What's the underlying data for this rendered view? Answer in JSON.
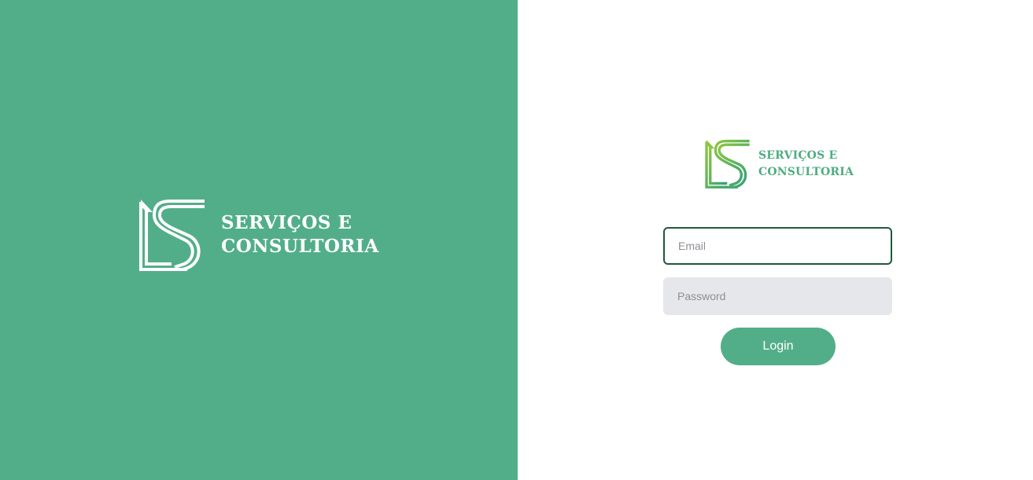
{
  "brand": {
    "line1": "SERVIÇOS E",
    "line2": "CONSULTORIA"
  },
  "login_form": {
    "email_placeholder": "Email",
    "password_placeholder": "Password",
    "login_label": "Login"
  },
  "colors": {
    "brand_green": "#52ae89",
    "focus_border": "#1e5a3a",
    "password_bg": "#e6e7ea"
  }
}
